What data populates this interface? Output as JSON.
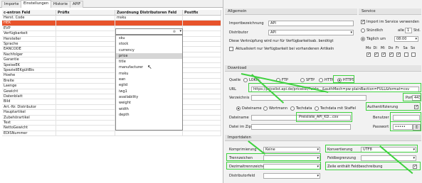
{
  "tabs": [
    "Importe",
    "Einstellungen",
    "Historie",
    "APIF"
  ],
  "grid": {
    "headers": [
      "c-entron Feld",
      "Prüfix",
      "Zuordnung Distributoren Feld",
      "Postfix"
    ],
    "rows": [
      {
        "c0": "Herst. Code",
        "c2": "msku"
      },
      {
        "c0": "HEK",
        "c2": "",
        "sel": true
      },
      {
        "c0": "EVP"
      },
      {
        "c0": "Verfügbarkeit"
      },
      {
        "c0": "Hersteller"
      },
      {
        "c0": "Sprache"
      },
      {
        "c0": "EANCODE"
      },
      {
        "c0": "Nachfolger"
      },
      {
        "c0": "Garantie"
      },
      {
        "c0": "SpeiseEK"
      },
      {
        "c0": "SpeziellEKgültBis"
      },
      {
        "c0": "Hoehe"
      },
      {
        "c0": "Breite"
      },
      {
        "c0": "Laenge"
      },
      {
        "c0": "Gewicht"
      },
      {
        "c0": "Datenblatt"
      },
      {
        "c0": "Bild"
      },
      {
        "c0": "Art.-Nr. Distributor"
      },
      {
        "c0": "Hauptartikel"
      },
      {
        "c0": "Zubehörartikel"
      },
      {
        "c0": "Text"
      },
      {
        "c0": "NettoGewicht"
      },
      {
        "c0": "EDISNummer"
      }
    ],
    "dropdown_items": [
      "sku",
      "stock",
      "currency",
      "price",
      "title",
      "manufacturer",
      "msku",
      "ean",
      "eglid",
      "iwg1",
      "availability",
      "weight",
      "width",
      "depth"
    ],
    "dropdown_highlight": "price"
  },
  "allgemein": {
    "title": "Allgemein",
    "importbez_label": "Importbezeichnung",
    "importbez_value": "API",
    "distributor_label": "Distributor",
    "distributor_value": "API",
    "note": "Diese Verknüpfung wird nur für Verfügbarkeitsab. benötigt",
    "aktual_label": "Aktualisiert nur Verfügbarkeit bei vorhandenen Artikeln"
  },
  "service": {
    "title": "Service",
    "import_label": "Import im Service verwenden",
    "stuendlich": "Stündlich",
    "alle": "alle",
    "alle_value": "1",
    "std": "Std.",
    "taeglich": "Täglich um",
    "time": "08:00",
    "days": [
      "Mo",
      "Di",
      "Mi",
      "Do",
      "Fr",
      "Sa",
      "So"
    ]
  },
  "download": {
    "title": "Download",
    "quelle": "Quelle",
    "protocols": [
      "LOKAL",
      "FTP",
      "SFTP",
      "HTTP",
      "HTTPS"
    ],
    "url_label": "URL",
    "url_value": "https://pricelist.api.de/pricelist/?cid=...&authMech=pw-plainBaction=FULL&format=csv",
    "verz_label": "Verzeichnis",
    "port_label": "Port",
    "port_value": "443",
    "auth_label": "Authentifizierung",
    "dateiname": "Dateiname",
    "wortmann": "Wortmann",
    "techdata": "Techdata",
    "techdata_staffel": "Techdata mit Staffel",
    "datei_label": "Dateiname",
    "datei_value": "Preisliste_API_KD...csv",
    "benutzer_label": "Benutzer",
    "zip_label": "Datei im Zip",
    "pass_label": "Passwort",
    "pass_value": "•••••"
  },
  "importdaten": {
    "title": "Importdaten",
    "komp_label": "Komprimierung",
    "komp_value": "Keine",
    "konv_label": "Konvertierung",
    "konv_value": "UTF8",
    "trenn_label": "Trennzeichen",
    "feldb_label": "Feldbegrenzung",
    "dez_label": "Dezimaltrennzeichen",
    "zeile_label": "Zeile enthält Feldbeschreibung",
    "distfeld_label": "Distributorfeld"
  }
}
